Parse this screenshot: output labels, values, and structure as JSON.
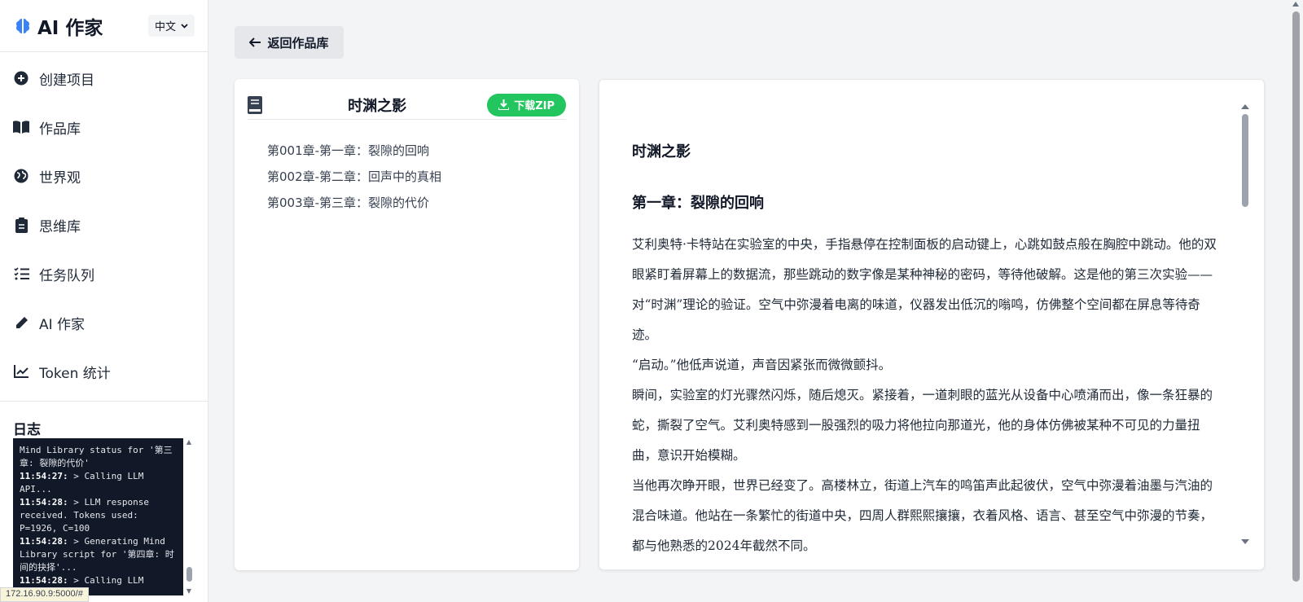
{
  "app": {
    "title": "AI 作家",
    "language": "中文"
  },
  "sidebar": {
    "items": [
      {
        "label": "创建项目",
        "icon": "plus-circle-icon"
      },
      {
        "label": "作品库",
        "icon": "open-book-icon"
      },
      {
        "label": "世界观",
        "icon": "globe-icon"
      },
      {
        "label": "思维库",
        "icon": "clipboard-icon"
      },
      {
        "label": "任务队列",
        "icon": "task-list-icon"
      },
      {
        "label": "AI 作家",
        "icon": "pen-icon"
      },
      {
        "label": "Token 统计",
        "icon": "line-chart-icon"
      }
    ],
    "log_title": "日志",
    "log_lines": [
      {
        "time": "",
        "text": "Mind Library status for '第三"
      },
      {
        "time": "",
        "text": "章: 裂隙的代价'"
      },
      {
        "time": "11:54:27:",
        "text": " > Calling LLM API..."
      },
      {
        "time": "11:54:28:",
        "text": " > LLM response received. Tokens used: P=1926, C=100"
      },
      {
        "time": "11:54:28:",
        "text": " > Generating Mind Library script for '第四章: 时间的抉择'..."
      },
      {
        "time": "11:54:28:",
        "text": " > Calling LLM API..."
      }
    ]
  },
  "status_url": "172.16.90.9:5000/#",
  "main": {
    "back_label": "返回作品库",
    "book_title": "时渊之影",
    "download_label": "下载ZIP",
    "chapters": [
      "第001章-第一章：裂隙的回响",
      "第002章-第二章：回声中的真相",
      "第003章-第三章：裂隙的代价"
    ],
    "content": {
      "title": "时渊之影",
      "chapter_title": "第一章：裂隙的回响",
      "paragraphs": [
        "艾利奥特·卡特站在实验室的中央，手指悬停在控制面板的启动键上，心跳如鼓点般在胸腔中跳动。他的双眼紧盯着屏幕上的数据流，那些跳动的数字像是某种神秘的密码，等待他破解。这是他的第三次实验——对“时渊”理论的验证。空气中弥漫着电离的味道，仪器发出低沉的嗡鸣，仿佛整个空间都在屏息等待奇迹。",
        "“启动。”他低声说道，声音因紧张而微微颤抖。",
        "瞬间，实验室的灯光骤然闪烁，随后熄灭。紧接着，一道刺眼的蓝光从设备中心喷涌而出，像一条狂暴的蛇，撕裂了空气。艾利奥特感到一股强烈的吸力将他拉向那道光，他的身体仿佛被某种不可见的力量扭曲，意识开始模糊。",
        "当他再次睁开眼，世界已经变了。高楼林立，街道上汽车的鸣笛声此起彼伏，空气中弥漫着油墨与汽油的混合味道。他站在一条繁忙的街道中央，四周人群熙熙攘攘，衣着风格、语言、甚至空气中弥漫的节奏，都与他熟悉的2024年截然不同。"
      ]
    }
  },
  "colors": {
    "brand_icon": "#3b82f6",
    "download_button": "#22c55e",
    "log_background": "#111827"
  }
}
